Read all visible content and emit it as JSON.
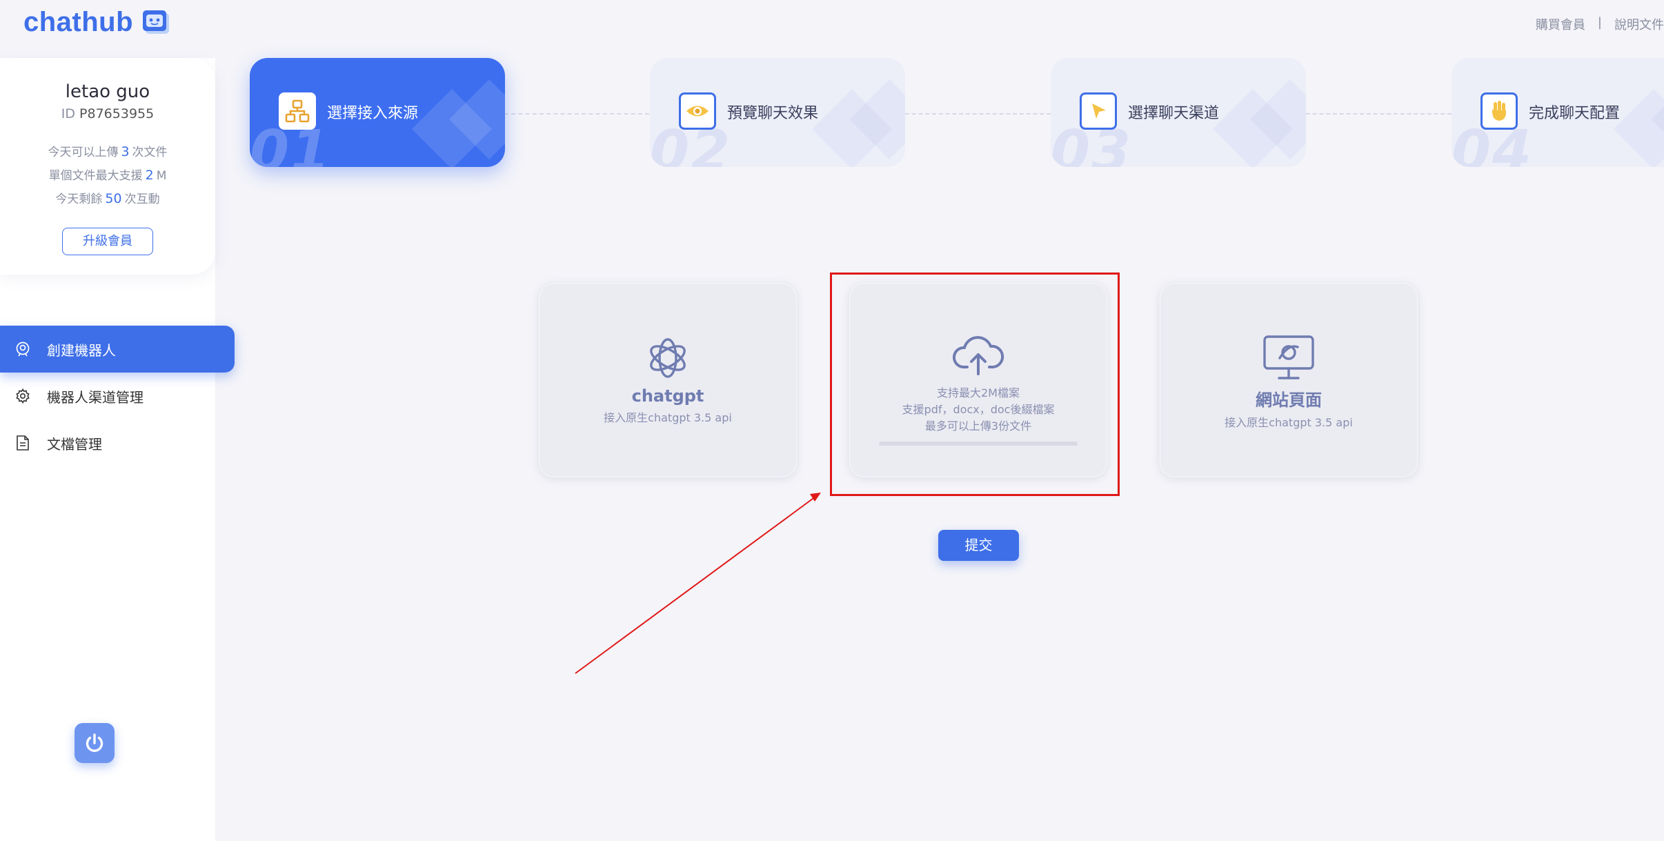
{
  "header": {
    "logo_text": "chathub",
    "links": [
      "購買會員",
      "|",
      "說明文件"
    ]
  },
  "user": {
    "name": "letao guo",
    "id_label": "ID",
    "id_value": "P87653955",
    "quota": [
      {
        "prefix": "今天可以上傳",
        "num": "3",
        "suffix": "次文件"
      },
      {
        "prefix": "單個文件最大支援",
        "num": "2",
        "suffix": "M"
      },
      {
        "prefix": "今天剩餘",
        "num": "50",
        "suffix": "次互動"
      }
    ],
    "upgrade_label": "升級會員"
  },
  "menu": [
    {
      "label": "創建機器人",
      "icon": "robot-icon",
      "active": true
    },
    {
      "label": "機器人渠道管理",
      "icon": "gear-icon",
      "active": false
    },
    {
      "label": "文檔管理",
      "icon": "document-icon",
      "active": false
    }
  ],
  "steps": [
    {
      "num": "01",
      "label": "選擇接入來源",
      "icon": "sitemap-icon"
    },
    {
      "num": "02",
      "label": "預覽聊天效果",
      "icon": "eye-icon"
    },
    {
      "num": "03",
      "label": "選擇聊天渠道",
      "icon": "cursor-icon"
    },
    {
      "num": "04",
      "label": "完成聊天配置",
      "icon": "hand-icon"
    }
  ],
  "cards": [
    {
      "title": "chatgpt",
      "sub": "接入原生chatgpt 3.5 api",
      "icon": "openai-icon"
    },
    {
      "lines": [
        "支持最大2M檔案",
        "支援pdf，docx，doc後綴檔案",
        "最多可以上傳3份文件"
      ],
      "icon": "cloud-upload-icon",
      "progress": 0
    },
    {
      "title": "網站頁面",
      "sub": "接入原生chatgpt 3.5 api",
      "icon": "website-icon"
    }
  ],
  "submit_label": "提交",
  "colors": {
    "accent": "#3e6fe8",
    "annotation": "#e01818",
    "background": "#f4f4f9"
  }
}
